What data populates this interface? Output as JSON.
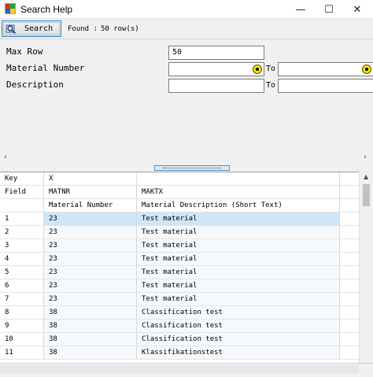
{
  "window": {
    "title": "Search Help",
    "minimize": "—",
    "maximize": "☐",
    "close": "✕"
  },
  "toolbar": {
    "search_label": "Search",
    "found_label": "Found :",
    "found_value": "50 row(s)"
  },
  "criteria": {
    "max_row_label": "Max Row",
    "max_row_value": "50",
    "material_number_label": "Material Number",
    "material_number_from": "",
    "material_number_to": "",
    "description_label": "Description",
    "description_from": "",
    "description_to": "",
    "to_label": "To"
  },
  "grid": {
    "key_row": [
      "Key",
      "X",
      "",
      ""
    ],
    "field_row": [
      "Field",
      "MATNR",
      "MAKTX",
      ""
    ],
    "desc_row": [
      "",
      "Material Number",
      "Material Description (Short Text)",
      ""
    ],
    "rows": [
      [
        "1",
        "23",
        "Test material"
      ],
      [
        "2",
        "23",
        "Test material"
      ],
      [
        "3",
        "23",
        "Test material"
      ],
      [
        "4",
        "23",
        "Test material"
      ],
      [
        "5",
        "23",
        "Test material"
      ],
      [
        "6",
        "23",
        "Test material"
      ],
      [
        "7",
        "23",
        "Test material"
      ],
      [
        "8",
        "38",
        "Classification test"
      ],
      [
        "9",
        "38",
        "Classification test"
      ],
      [
        "10",
        "38",
        "Classification test"
      ],
      [
        "11",
        "38",
        "Klassifikationstest"
      ]
    ],
    "selected_row": 1
  },
  "colors": {
    "selection": "#cfe6f8",
    "f4_help": "#f5e100"
  },
  "icons": {
    "app": "app-icon",
    "search": "search-icon",
    "f4": "value-help-icon"
  }
}
